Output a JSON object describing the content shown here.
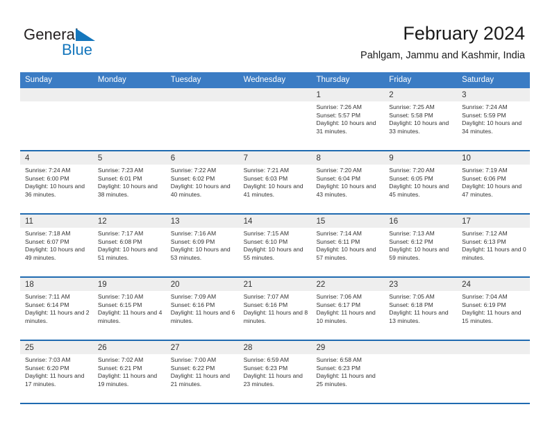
{
  "brand": {
    "name_part1": "General",
    "name_part2": "Blue",
    "flag_icon": "blue-triangle-flag-icon"
  },
  "header": {
    "title": "February 2024",
    "subtitle": "Pahlgam, Jammu and Kashmir, India"
  },
  "calendar": {
    "weekdays": [
      "Sunday",
      "Monday",
      "Tuesday",
      "Wednesday",
      "Thursday",
      "Friday",
      "Saturday"
    ],
    "accent_color": "#3b7cc4",
    "row_divider_color": "#1f6ab0",
    "day_strip_color": "#eeeeee",
    "weeks": [
      [
        {
          "day": "",
          "empty": true
        },
        {
          "day": "",
          "empty": true
        },
        {
          "day": "",
          "empty": true
        },
        {
          "day": "",
          "empty": true
        },
        {
          "day": "1",
          "sunrise": "Sunrise: 7:26 AM",
          "sunset": "Sunset: 5:57 PM",
          "daylight": "Daylight: 10 hours and 31 minutes."
        },
        {
          "day": "2",
          "sunrise": "Sunrise: 7:25 AM",
          "sunset": "Sunset: 5:58 PM",
          "daylight": "Daylight: 10 hours and 33 minutes."
        },
        {
          "day": "3",
          "sunrise": "Sunrise: 7:24 AM",
          "sunset": "Sunset: 5:59 PM",
          "daylight": "Daylight: 10 hours and 34 minutes."
        }
      ],
      [
        {
          "day": "4",
          "sunrise": "Sunrise: 7:24 AM",
          "sunset": "Sunset: 6:00 PM",
          "daylight": "Daylight: 10 hours and 36 minutes."
        },
        {
          "day": "5",
          "sunrise": "Sunrise: 7:23 AM",
          "sunset": "Sunset: 6:01 PM",
          "daylight": "Daylight: 10 hours and 38 minutes."
        },
        {
          "day": "6",
          "sunrise": "Sunrise: 7:22 AM",
          "sunset": "Sunset: 6:02 PM",
          "daylight": "Daylight: 10 hours and 40 minutes."
        },
        {
          "day": "7",
          "sunrise": "Sunrise: 7:21 AM",
          "sunset": "Sunset: 6:03 PM",
          "daylight": "Daylight: 10 hours and 41 minutes."
        },
        {
          "day": "8",
          "sunrise": "Sunrise: 7:20 AM",
          "sunset": "Sunset: 6:04 PM",
          "daylight": "Daylight: 10 hours and 43 minutes."
        },
        {
          "day": "9",
          "sunrise": "Sunrise: 7:20 AM",
          "sunset": "Sunset: 6:05 PM",
          "daylight": "Daylight: 10 hours and 45 minutes."
        },
        {
          "day": "10",
          "sunrise": "Sunrise: 7:19 AM",
          "sunset": "Sunset: 6:06 PM",
          "daylight": "Daylight: 10 hours and 47 minutes."
        }
      ],
      [
        {
          "day": "11",
          "sunrise": "Sunrise: 7:18 AM",
          "sunset": "Sunset: 6:07 PM",
          "daylight": "Daylight: 10 hours and 49 minutes."
        },
        {
          "day": "12",
          "sunrise": "Sunrise: 7:17 AM",
          "sunset": "Sunset: 6:08 PM",
          "daylight": "Daylight: 10 hours and 51 minutes."
        },
        {
          "day": "13",
          "sunrise": "Sunrise: 7:16 AM",
          "sunset": "Sunset: 6:09 PM",
          "daylight": "Daylight: 10 hours and 53 minutes."
        },
        {
          "day": "14",
          "sunrise": "Sunrise: 7:15 AM",
          "sunset": "Sunset: 6:10 PM",
          "daylight": "Daylight: 10 hours and 55 minutes."
        },
        {
          "day": "15",
          "sunrise": "Sunrise: 7:14 AM",
          "sunset": "Sunset: 6:11 PM",
          "daylight": "Daylight: 10 hours and 57 minutes."
        },
        {
          "day": "16",
          "sunrise": "Sunrise: 7:13 AM",
          "sunset": "Sunset: 6:12 PM",
          "daylight": "Daylight: 10 hours and 59 minutes."
        },
        {
          "day": "17",
          "sunrise": "Sunrise: 7:12 AM",
          "sunset": "Sunset: 6:13 PM",
          "daylight": "Daylight: 11 hours and 0 minutes."
        }
      ],
      [
        {
          "day": "18",
          "sunrise": "Sunrise: 7:11 AM",
          "sunset": "Sunset: 6:14 PM",
          "daylight": "Daylight: 11 hours and 2 minutes."
        },
        {
          "day": "19",
          "sunrise": "Sunrise: 7:10 AM",
          "sunset": "Sunset: 6:15 PM",
          "daylight": "Daylight: 11 hours and 4 minutes."
        },
        {
          "day": "20",
          "sunrise": "Sunrise: 7:09 AM",
          "sunset": "Sunset: 6:16 PM",
          "daylight": "Daylight: 11 hours and 6 minutes."
        },
        {
          "day": "21",
          "sunrise": "Sunrise: 7:07 AM",
          "sunset": "Sunset: 6:16 PM",
          "daylight": "Daylight: 11 hours and 8 minutes."
        },
        {
          "day": "22",
          "sunrise": "Sunrise: 7:06 AM",
          "sunset": "Sunset: 6:17 PM",
          "daylight": "Daylight: 11 hours and 10 minutes."
        },
        {
          "day": "23",
          "sunrise": "Sunrise: 7:05 AM",
          "sunset": "Sunset: 6:18 PM",
          "daylight": "Daylight: 11 hours and 13 minutes."
        },
        {
          "day": "24",
          "sunrise": "Sunrise: 7:04 AM",
          "sunset": "Sunset: 6:19 PM",
          "daylight": "Daylight: 11 hours and 15 minutes."
        }
      ],
      [
        {
          "day": "25",
          "sunrise": "Sunrise: 7:03 AM",
          "sunset": "Sunset: 6:20 PM",
          "daylight": "Daylight: 11 hours and 17 minutes."
        },
        {
          "day": "26",
          "sunrise": "Sunrise: 7:02 AM",
          "sunset": "Sunset: 6:21 PM",
          "daylight": "Daylight: 11 hours and 19 minutes."
        },
        {
          "day": "27",
          "sunrise": "Sunrise: 7:00 AM",
          "sunset": "Sunset: 6:22 PM",
          "daylight": "Daylight: 11 hours and 21 minutes."
        },
        {
          "day": "28",
          "sunrise": "Sunrise: 6:59 AM",
          "sunset": "Sunset: 6:23 PM",
          "daylight": "Daylight: 11 hours and 23 minutes."
        },
        {
          "day": "29",
          "sunrise": "Sunrise: 6:58 AM",
          "sunset": "Sunset: 6:23 PM",
          "daylight": "Daylight: 11 hours and 25 minutes."
        },
        {
          "day": "",
          "empty": true
        },
        {
          "day": "",
          "empty": true
        }
      ]
    ]
  }
}
